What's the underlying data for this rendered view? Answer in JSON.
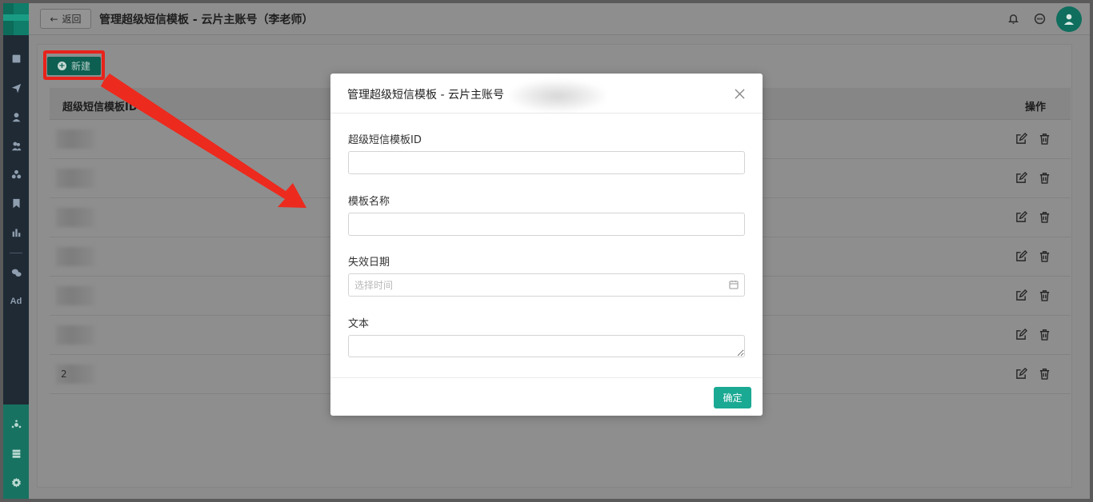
{
  "header": {
    "back_label": "返回",
    "title": "管理超级短信模板 - 云片主账号（李老师）"
  },
  "sidebar": {
    "items": [
      "doc-icon",
      "send-icon",
      "user-icon",
      "users-icon",
      "group-icon",
      "bookmark-icon",
      "chart-icon",
      "wechat-icon",
      "Ad"
    ],
    "bottom_items": [
      "hub-icon",
      "server-icon",
      "settings-icon"
    ],
    "ad_label": "Ad"
  },
  "toolbar": {
    "new_label": "新建"
  },
  "table": {
    "columns": [
      "超级短信模板ID",
      "操作"
    ],
    "rows": [
      {
        "id": ""
      },
      {
        "id": ""
      },
      {
        "id": ""
      },
      {
        "id": ""
      },
      {
        "id": ""
      },
      {
        "id": ""
      },
      {
        "id": "2"
      }
    ]
  },
  "modal": {
    "title": "管理超级短信模板 - 云片主账号",
    "fields": {
      "template_id_label": "超级短信模板ID",
      "template_name_label": "模板名称",
      "expire_date_label": "失效日期",
      "expire_date_placeholder": "选择时间",
      "text_label": "文本"
    },
    "confirm_label": "确定"
  },
  "colors": {
    "accent": "#1aa993",
    "highlight": "#e8231b",
    "sidebar_bg": "#1f2a35"
  }
}
